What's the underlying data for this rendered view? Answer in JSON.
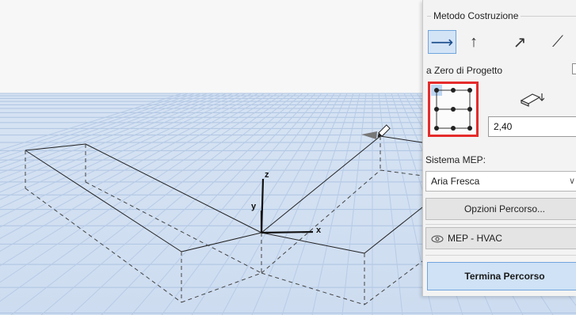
{
  "viewport": {
    "axes": {
      "x_label": "x",
      "y_label": "y",
      "z_label": "z"
    }
  },
  "panel": {
    "method_group_title": "Metodo Costruzione",
    "method_buttons": [
      {
        "icon": "arrow-right-icon",
        "glyph": "⟶",
        "active": true
      },
      {
        "icon": "arrow-up-icon",
        "glyph": "↑",
        "active": false
      },
      {
        "icon": "arrow-diagonal-icon",
        "glyph": "↗",
        "active": false
      },
      {
        "icon": "slope-icon",
        "glyph": "⟋",
        "active": false
      }
    ],
    "zero_label": "a Zero di Progetto",
    "height_value": "2,40",
    "mep_system_label": "Sistema MEP:",
    "mep_system_value": "Aria Fresca",
    "route_options_label": "Opzioni Percorso...",
    "layer_label": "MEP - HVAC",
    "finish_label": "Termina Percorso",
    "colors": {
      "highlight_border": "#e52b2b",
      "active_fill": "#d4e4f7",
      "accent": "#6fa5de"
    }
  }
}
